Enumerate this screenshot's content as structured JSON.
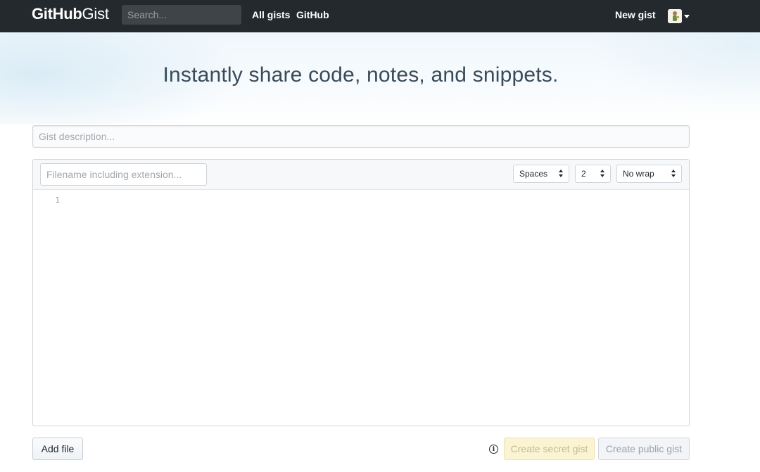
{
  "header": {
    "logo_bold": "GitHub",
    "logo_light": "Gist",
    "search_placeholder": "Search...",
    "nav": [
      "All gists",
      "GitHub"
    ],
    "new_gist": "New gist",
    "avatar_icon": "user-avatar",
    "dropdown_icon": "caret-down-icon"
  },
  "hero": {
    "title": "Instantly share code, notes, and snippets."
  },
  "form": {
    "description_placeholder": "Gist description...",
    "filename_placeholder": "Filename including extension...",
    "indent_mode": "Spaces",
    "indent_size": "2",
    "wrap_mode": "No wrap",
    "line_numbers": [
      "1"
    ]
  },
  "actions": {
    "add_file": "Add file",
    "info_icon": "info-icon",
    "create_secret": "Create secret gist",
    "create_public": "Create public gist"
  },
  "colors": {
    "header_bg": "#24292e",
    "secret_button_bg": "#fbf4d3",
    "public_button_bg": "#f2f4f7"
  }
}
